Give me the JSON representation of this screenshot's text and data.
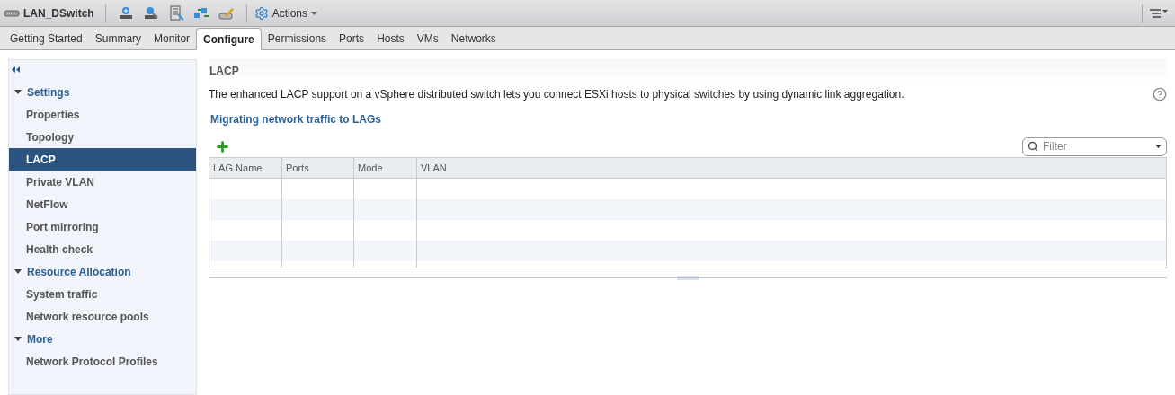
{
  "toolbar": {
    "title": "LAN_DSwitch",
    "actions_label": "Actions"
  },
  "tabs": [
    {
      "label": "Getting Started",
      "selected": false
    },
    {
      "label": "Summary",
      "selected": false
    },
    {
      "label": "Monitor",
      "selected": false
    },
    {
      "label": "Configure",
      "selected": true
    },
    {
      "label": "Permissions",
      "selected": false
    },
    {
      "label": "Ports",
      "selected": false
    },
    {
      "label": "Hosts",
      "selected": false
    },
    {
      "label": "VMs",
      "selected": false
    },
    {
      "label": "Networks",
      "selected": false
    }
  ],
  "sidebar": {
    "items": [
      {
        "label": "Settings",
        "expanded": true,
        "children": [
          {
            "label": "Properties",
            "selected": false
          },
          {
            "label": "Topology",
            "selected": false
          },
          {
            "label": "LACP",
            "selected": true
          },
          {
            "label": "Private VLAN",
            "selected": false
          },
          {
            "label": "NetFlow",
            "selected": false
          },
          {
            "label": "Port mirroring",
            "selected": false
          },
          {
            "label": "Health check",
            "selected": false
          }
        ]
      },
      {
        "label": "Resource Allocation",
        "expanded": true,
        "children": [
          {
            "label": "System traffic",
            "selected": false
          },
          {
            "label": "Network resource pools",
            "selected": false
          }
        ]
      },
      {
        "label": "More",
        "expanded": true,
        "children": [
          {
            "label": "Network Protocol Profiles",
            "selected": false
          }
        ]
      }
    ]
  },
  "panel": {
    "title": "LACP",
    "description": "The enhanced LACP support on a vSphere distributed switch lets you connect ESXi hosts to physical switches by using dynamic link aggregation.",
    "link": "Migrating network traffic to LAGs",
    "filter": {
      "placeholder": "Filter"
    },
    "table": {
      "columns": [
        "LAG Name",
        "Ports",
        "Mode",
        "VLAN"
      ]
    }
  }
}
